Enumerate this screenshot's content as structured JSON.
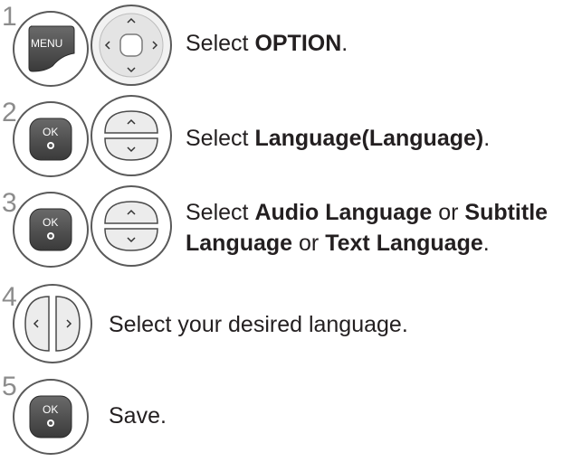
{
  "steps": [
    {
      "number": "1",
      "buttons": [
        "menu-button-icon",
        "directional-pad-icon"
      ],
      "button_labels": {
        "menu": "MENU"
      },
      "text": [
        {
          "t": "Select ",
          "bold": false
        },
        {
          "t": "OPTION",
          "bold": true
        },
        {
          "t": ".",
          "bold": false
        }
      ]
    },
    {
      "number": "2",
      "buttons": [
        "ok-button-icon",
        "up-down-button-icon"
      ],
      "button_labels": {
        "ok": "OK"
      },
      "text": [
        {
          "t": "Select ",
          "bold": false
        },
        {
          "t": "Language(Language)",
          "bold": true
        },
        {
          "t": ".",
          "bold": false
        }
      ]
    },
    {
      "number": "3",
      "buttons": [
        "ok-button-icon",
        "up-down-button-icon"
      ],
      "button_labels": {
        "ok": "OK"
      },
      "text_line1": [
        {
          "t": "Select ",
          "bold": false
        },
        {
          "t": "Audio Language",
          "bold": true
        },
        {
          "t": " or ",
          "bold": false
        },
        {
          "t": "Subtitle",
          "bold": true
        }
      ],
      "text_line2": [
        {
          "t": "Language",
          "bold": true
        },
        {
          "t": " or ",
          "bold": false
        },
        {
          "t": "Text Language",
          "bold": true
        },
        {
          "t": ".",
          "bold": false
        }
      ]
    },
    {
      "number": "4",
      "buttons": [
        "left-right-button-icon"
      ],
      "text": [
        {
          "t": "Select your desired language.",
          "bold": false
        }
      ]
    },
    {
      "number": "5",
      "buttons": [
        "ok-button-icon"
      ],
      "button_labels": {
        "ok": "OK"
      },
      "text": [
        {
          "t": "Save.",
          "bold": false
        }
      ]
    }
  ],
  "colors": {
    "button_dark": "#4a4a4a",
    "button_light": "#e6e6e6",
    "outline": "#5a5a5a",
    "step_number": "#8c8c8c",
    "text": "#231f20"
  }
}
